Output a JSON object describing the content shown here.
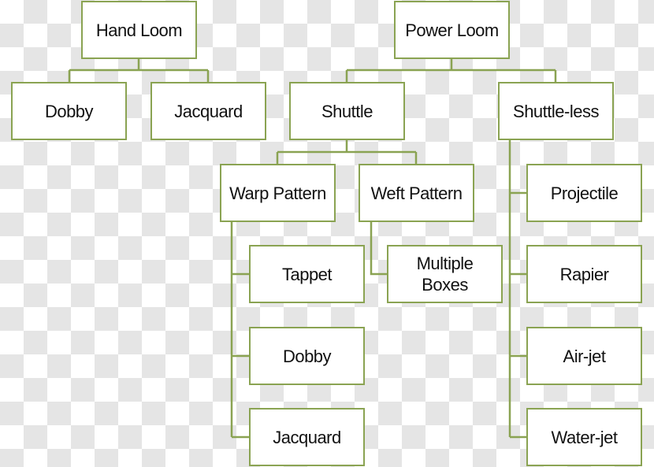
{
  "colors": {
    "border": "#8aa352",
    "connector": "#8aa352"
  },
  "nodes": {
    "hand_loom": "Hand Loom",
    "power_loom": "Power Loom",
    "dobby_hand": "Dobby",
    "jacquard_hand": "Jacquard",
    "shuttle": "Shuttle",
    "shuttle_less": "Shuttle-less",
    "warp_pattern": "Warp Pattern",
    "weft_pattern": "Weft Pattern",
    "projectile": "Projectile",
    "tappet": "Tappet",
    "multiple_boxes": "Multiple Boxes",
    "rapier": "Rapier",
    "dobby_warp": "Dobby",
    "air_jet": "Air-jet",
    "jacquard_warp": "Jacquard",
    "water_jet": "Water-jet"
  }
}
